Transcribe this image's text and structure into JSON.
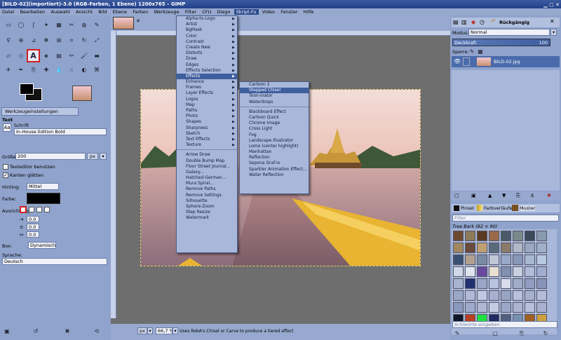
{
  "window": {
    "title": "[BILD-02](importiert)-3.0 (RGB-Farben, 1 Ebene) 1200x765 – GIMP"
  },
  "menubar": [
    "Datei",
    "Bearbeiten",
    "Auswahl",
    "Ansicht",
    "Bild",
    "Ebene",
    "Farben",
    "Werkzeuge",
    "Filter",
    "CFU",
    "Diego",
    "Skript-Fu",
    "Video",
    "Fenster",
    "Hilfe"
  ],
  "script_fu_menu": [
    "Alpha-to-Logo",
    "Artist",
    "BgMask",
    "Color",
    "Contrast",
    "Create New",
    "Distorts",
    "Draw",
    "Edges",
    "Effects Selection",
    "Effects",
    "Enhance",
    "Frames",
    "Layer Effects",
    "Logos",
    "Map",
    "Paths",
    "Photo",
    "Shapes",
    "Sharpness",
    "Sketch",
    "Text Effects",
    "Texture",
    "Arrow Draw",
    "Double Bump Map",
    "Floor Street Journal...",
    "Galaxy...",
    "Hatched-German...",
    "Mura Spiral...",
    "Remove Paths",
    "Remove Settings",
    "Silhouette",
    "Sphere-Zoom",
    "Step Resize",
    "Watermark"
  ],
  "effects_submenu_a": [
    "Cartoon 2",
    "Stepped Chisel",
    "Toon-inator",
    "Waterdrops"
  ],
  "effects_submenu_b": [
    "Blackboard Effect",
    "Cartoon Quick",
    "Chrome Image",
    "Cross Light",
    "Fog",
    "Landscape Illustrator",
    "Lomo (center highlight)",
    "Manhattan",
    "Reflection",
    "Sepona Graf-ix",
    "Sparkler Animation Effect...",
    "Water Reflection"
  ],
  "tool_options": {
    "tab": "Werkzeugeinstellungen",
    "section": "Text",
    "font_label": "Schrift",
    "font_value": "In-House Edition Bold",
    "size_label": "Größe",
    "size_value": "200",
    "size_unit": "px",
    "editor_label": "Texteditor benutzen",
    "antialias_label": "Kanten glätten",
    "hinting_label": "Hinting:",
    "hinting_value": "Mittel",
    "color_label": "Farbe:",
    "justify_label": "Ausrichtung:",
    "indent_value": "0.0",
    "linespacing_value": "0.0",
    "letterspacing_value": "0.0",
    "box_label": "Box:",
    "box_value": "Dynamisch",
    "language_label": "Sprache:",
    "language_value": "Deutsch"
  },
  "layers": {
    "undo_label": "Rückgängig",
    "mode_label": "Modus:",
    "mode_value": "Normal",
    "opacity_label": "Deckkraft",
    "opacity_value": "100",
    "lock_label": "Sperre:",
    "layer_name": "BILD-02.jpg"
  },
  "brushes": {
    "tabs": [
      "Pinsel",
      "Farbverläufe",
      "Muster"
    ],
    "filter_placeholder": "Filter",
    "pattern_name": "Tree Bark (82 × 90)",
    "tag_placeholder": "Schlwörte eingeben"
  },
  "status": {
    "unit": "px",
    "zoom": "66,7 %",
    "message": "Uses RobA's Chisel or Carve to produce a tiered effect"
  },
  "colors": {
    "accent": "#3f5e9e",
    "highlight": "#d02020",
    "panel": "#97a9cf"
  }
}
